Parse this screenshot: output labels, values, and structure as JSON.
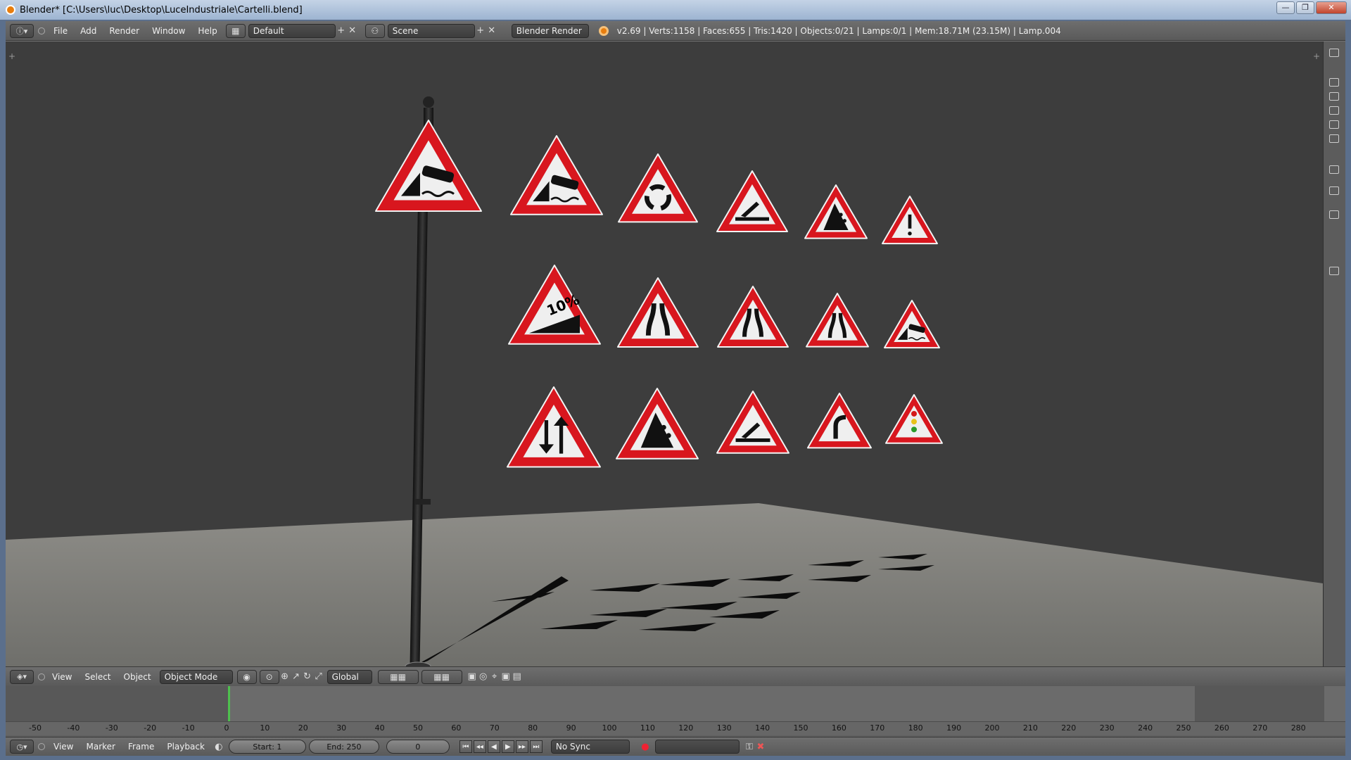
{
  "window": {
    "title": "Blender* [C:\\Users\\luc\\Desktop\\LuceIndustriale\\Cartelli.blend]",
    "controls": [
      "—",
      "❐",
      "✕"
    ]
  },
  "topbar": {
    "menus": [
      "File",
      "Add",
      "Render",
      "Window",
      "Help"
    ],
    "screen_layout": "Default",
    "scene": "Scene",
    "render_engine": "Blender Render",
    "stats": "v2.69 | Verts:1158 | Faces:655 | Tris:1420 | Objects:0/21 | Lamps:0/1 | Mem:18.71M (23.15M) | Lamp.004"
  },
  "view3d_header": {
    "menus": [
      "View",
      "Select",
      "Object"
    ],
    "mode": "Object Mode",
    "orientation": "Global"
  },
  "timeline": {
    "ticks": [
      "-50",
      "-40",
      "-30",
      "-20",
      "-10",
      "0",
      "10",
      "20",
      "30",
      "40",
      "50",
      "60",
      "70",
      "80",
      "90",
      "100",
      "110",
      "120",
      "130",
      "140",
      "150",
      "160",
      "170",
      "180",
      "190",
      "200",
      "210",
      "220",
      "230",
      "240",
      "250",
      "260",
      "270",
      "280"
    ],
    "menus": [
      "View",
      "Marker",
      "Frame",
      "Playback"
    ],
    "start": "Start: 1",
    "end": "End: 250",
    "current_frame": "0",
    "sync": "No Sync"
  },
  "scene_signs": {
    "count": 16,
    "colors": {
      "border": "#d8161e",
      "fill": "#efefef",
      "symbol": "#111111"
    },
    "label_10pct": "10%"
  }
}
